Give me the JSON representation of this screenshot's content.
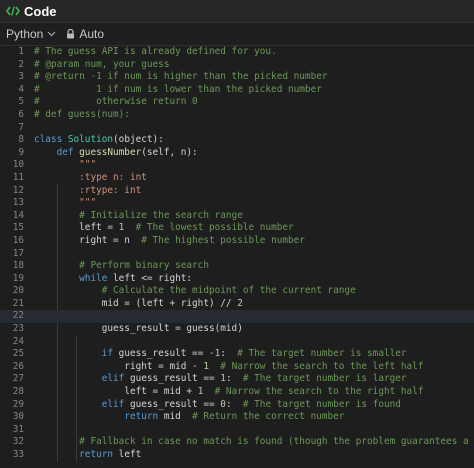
{
  "window": {
    "title": "Code",
    "icon": "code-brackets-icon"
  },
  "toolbar": {
    "language": "Python",
    "language_chevron": "chevron-down-icon",
    "lock_icon": "lock-icon",
    "auto_label": "Auto"
  },
  "colors": {
    "background": "#1e1e1e",
    "comment": "#6a9955",
    "keyword": "#569cd6",
    "function": "#dcdcaa",
    "class": "#4ec9b0",
    "number": "#b5cea8",
    "string": "#ce9178",
    "code_icon": "#3fb950"
  },
  "editor": {
    "active_line": 22,
    "lines": [
      [
        [
          "cm",
          "# The guess API is already defined for you."
        ]
      ],
      [
        [
          "cm",
          "# @param num, your guess"
        ]
      ],
      [
        [
          "cm",
          "# @return -1 if num is higher than the picked number"
        ]
      ],
      [
        [
          "cm",
          "#          1 if num is lower than the picked number"
        ]
      ],
      [
        [
          "cm",
          "#          otherwise return 0"
        ]
      ],
      [
        [
          "cm",
          "# def guess(num):"
        ]
      ],
      [],
      [
        [
          "kw",
          "class "
        ],
        [
          "cls",
          "Solution"
        ],
        [
          "",
          "(object):"
        ]
      ],
      [
        [
          "",
          "    "
        ],
        [
          "kw",
          "def "
        ],
        [
          "fn",
          "guessNumber"
        ],
        [
          "",
          "(self, n):"
        ]
      ],
      [
        [
          "",
          "        "
        ],
        [
          "str",
          "\"\"\""
        ]
      ],
      [
        [
          "",
          "        "
        ],
        [
          "str",
          ":type n: int"
        ]
      ],
      [
        [
          "",
          "        "
        ],
        [
          "str",
          ":rtype: int"
        ]
      ],
      [
        [
          "",
          "        "
        ],
        [
          "str",
          "\"\"\""
        ]
      ],
      [
        [
          "",
          "        "
        ],
        [
          "cm",
          "# Initialize the search range"
        ]
      ],
      [
        [
          "",
          "        left = "
        ],
        [
          "num",
          "1"
        ],
        [
          "",
          "  "
        ],
        [
          "cm",
          "# The lowest possible number"
        ]
      ],
      [
        [
          "",
          "        right = n  "
        ],
        [
          "cm",
          "# The highest possible number"
        ]
      ],
      [],
      [
        [
          "",
          "        "
        ],
        [
          "cm",
          "# Perform binary search"
        ]
      ],
      [
        [
          "",
          "        "
        ],
        [
          "kw",
          "while "
        ],
        [
          "",
          "left <= right:"
        ]
      ],
      [
        [
          "",
          "            "
        ],
        [
          "cm",
          "# Calculate the midpoint of the current range"
        ]
      ],
      [
        [
          "",
          "            mid = (left + right) // "
        ],
        [
          "num",
          "2"
        ]
      ],
      [],
      [
        [
          "",
          "            guess_result = guess(mid)"
        ]
      ],
      [],
      [
        [
          "",
          "            "
        ],
        [
          "kw",
          "if "
        ],
        [
          "",
          "guess_result == "
        ],
        [
          "num",
          "-1"
        ],
        [
          "",
          ":  "
        ],
        [
          "cm",
          "# The target number is smaller"
        ]
      ],
      [
        [
          "",
          "                right = mid - "
        ],
        [
          "num",
          "1"
        ],
        [
          "",
          "  "
        ],
        [
          "cm",
          "# Narrow the search to the left half"
        ]
      ],
      [
        [
          "",
          "            "
        ],
        [
          "kw",
          "elif "
        ],
        [
          "",
          "guess_result == "
        ],
        [
          "num",
          "1"
        ],
        [
          "",
          ":  "
        ],
        [
          "cm",
          "# The target number is larger"
        ]
      ],
      [
        [
          "",
          "                left = mid + "
        ],
        [
          "num",
          "1"
        ],
        [
          "",
          "  "
        ],
        [
          "cm",
          "# Narrow the search to the right half"
        ]
      ],
      [
        [
          "",
          "            "
        ],
        [
          "kw",
          "elif "
        ],
        [
          "",
          "guess_result == "
        ],
        [
          "num",
          "0"
        ],
        [
          "",
          ":  "
        ],
        [
          "cm",
          "# The target number is found"
        ]
      ],
      [
        [
          "",
          "                "
        ],
        [
          "kw",
          "return "
        ],
        [
          "",
          "mid  "
        ],
        [
          "cm",
          "# Return the correct number"
        ]
      ],
      [],
      [
        [
          "",
          "        "
        ],
        [
          "cm",
          "# Fallback in case no match is found (though the problem guarantees a match)"
        ]
      ],
      [
        [
          "",
          "        "
        ],
        [
          "kw",
          "return "
        ],
        [
          "",
          "left"
        ]
      ]
    ]
  }
}
